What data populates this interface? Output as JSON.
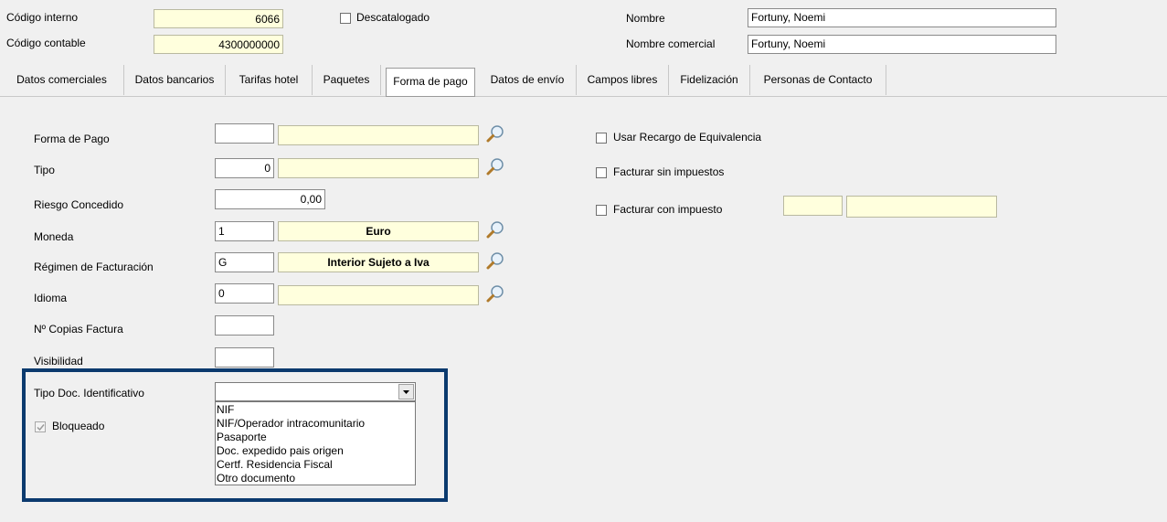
{
  "header": {
    "codigo_interno_label": "Código interno",
    "codigo_interno_value": "6066",
    "codigo_contable_label": "Código contable",
    "codigo_contable_value": "4300000000",
    "descatalogado_label": "Descatalogado",
    "nombre_label": "Nombre",
    "nombre_value": "Fortuny, Noemi",
    "nombre_comercial_label": "Nombre comercial",
    "nombre_comercial_value": "Fortuny, Noemi"
  },
  "tabs": [
    {
      "label": "Datos comerciales"
    },
    {
      "label": "Datos bancarios"
    },
    {
      "label": "Tarifas hotel"
    },
    {
      "label": "Paquetes"
    },
    {
      "label": "Forma de pago"
    },
    {
      "label": "Datos de envío"
    },
    {
      "label": "Campos libres"
    },
    {
      "label": "Fidelización"
    },
    {
      "label": "Personas de Contacto"
    }
  ],
  "form": {
    "forma_pago_label": "Forma de Pago",
    "forma_pago_code": "",
    "forma_pago_desc": "",
    "tipo_label": "Tipo",
    "tipo_code": "0",
    "tipo_desc": "",
    "riesgo_label": "Riesgo Concedido",
    "riesgo_value": "0,00",
    "moneda_label": "Moneda",
    "moneda_code": "1",
    "moneda_desc": "Euro",
    "regimen_label": "Régimen de Facturación",
    "regimen_code": "G",
    "regimen_desc": "Interior Sujeto a Iva",
    "idioma_label": "Idioma",
    "idioma_code": "0",
    "idioma_desc": "",
    "copias_label": "Nº Copias Factura",
    "copias_value": "",
    "visibilidad_label": "Visibilidad",
    "visibilidad_value": "",
    "tipo_doc_label": "Tipo Doc. Identificativo",
    "tipo_doc_selected": "",
    "tipo_doc_options": [
      "NIF",
      "NIF/Operador intracomunitario",
      "Pasaporte",
      "Doc. expedido pais origen",
      "Certf. Residencia Fiscal",
      "Otro documento"
    ],
    "bloqueado_label": "Bloqueado"
  },
  "options": {
    "recargo_label": "Usar Recargo de Equivalencia",
    "sin_impuestos_label": "Facturar sin impuestos",
    "con_impuesto_label": "Facturar con impuesto",
    "con_impuesto_code": "",
    "con_impuesto_desc": ""
  },
  "colors": {
    "highlight_border": "#0b3a6e",
    "field_yellow": "#ffffdd"
  }
}
